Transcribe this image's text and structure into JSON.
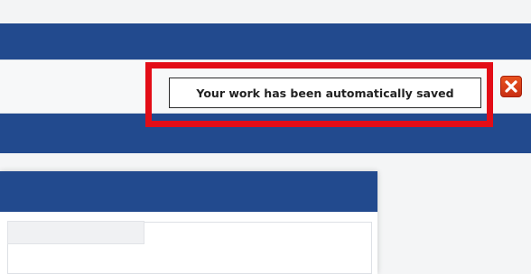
{
  "notification": {
    "message": "Your work has been automatically saved"
  },
  "icons": {
    "close": "close-icon"
  },
  "colors": {
    "brand_blue": "#224a8e",
    "highlight_red": "#e30d17",
    "close_orange": "#d8401a"
  }
}
